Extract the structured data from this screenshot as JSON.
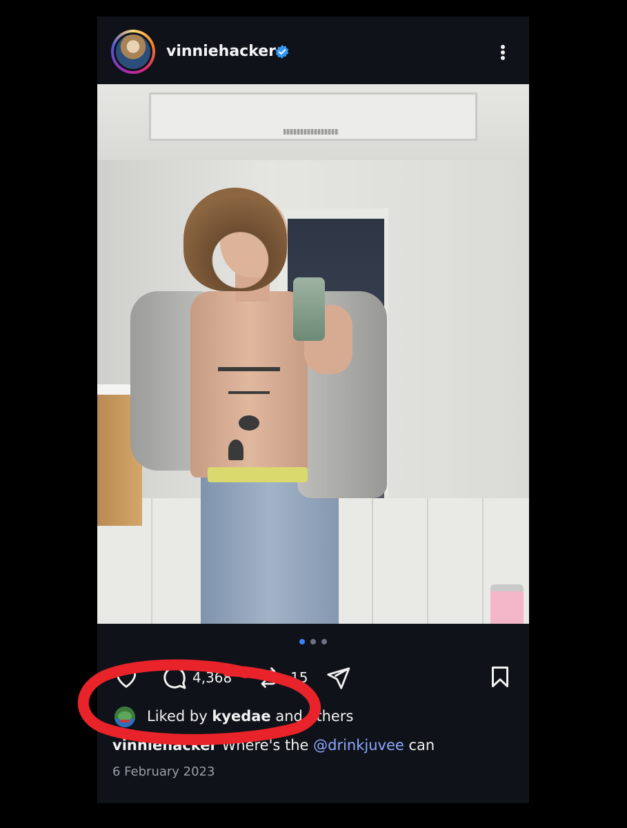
{
  "header": {
    "username": "vinniehacker",
    "verified_icon": "verified-badge-icon",
    "more_icon": "more-vertical-icon"
  },
  "carousel": {
    "total": 3,
    "active": 1,
    "active_color": "#3b82f6",
    "inactive_color": "#6b7280"
  },
  "actions": {
    "like_icon": "heart-icon",
    "comment_icon": "comment-icon",
    "comment_count": "4,368",
    "repost_icon": "repost-icon",
    "repost_count": "15",
    "share_icon": "send-icon",
    "save_icon": "bookmark-icon"
  },
  "likes": {
    "prefix": "Liked by ",
    "user": "kyedae",
    "suffix": " and others"
  },
  "caption": {
    "username": "vinniehacker",
    "text_before": " Where's the ",
    "mention": "@drinkjuvee",
    "text_after": " can"
  },
  "date": "6 February 2023",
  "annotation_color": "#e8232a"
}
